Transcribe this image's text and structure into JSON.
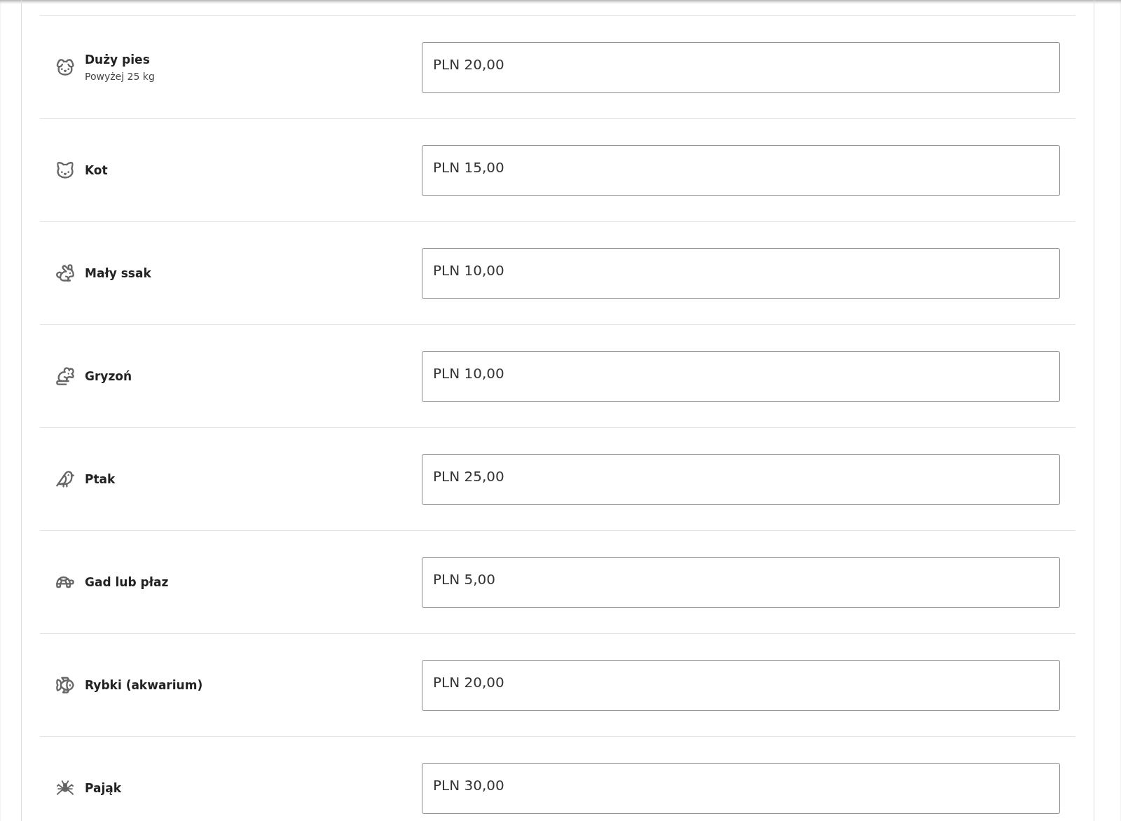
{
  "rows": [
    {
      "kind": "large-dog",
      "name": "Duży pies",
      "subtitle": "Powyżej 25 kg",
      "value": "PLN 20,00"
    },
    {
      "kind": "cat",
      "name": "Kot",
      "value": "PLN 15,00"
    },
    {
      "kind": "small-mammal",
      "name": "Mały ssak",
      "value": "PLN 10,00"
    },
    {
      "kind": "rodent",
      "name": "Gryzoń",
      "value": "PLN 10,00"
    },
    {
      "kind": "bird",
      "name": "Ptak",
      "value": "PLN 25,00"
    },
    {
      "kind": "reptile",
      "name": "Gad lub płaz",
      "value": "PLN 5,00"
    },
    {
      "kind": "fish",
      "name": "Rybki (akwarium)",
      "value": "PLN 20,00"
    },
    {
      "kind": "spider",
      "name": "Pająk",
      "value": "PLN 30,00"
    }
  ]
}
